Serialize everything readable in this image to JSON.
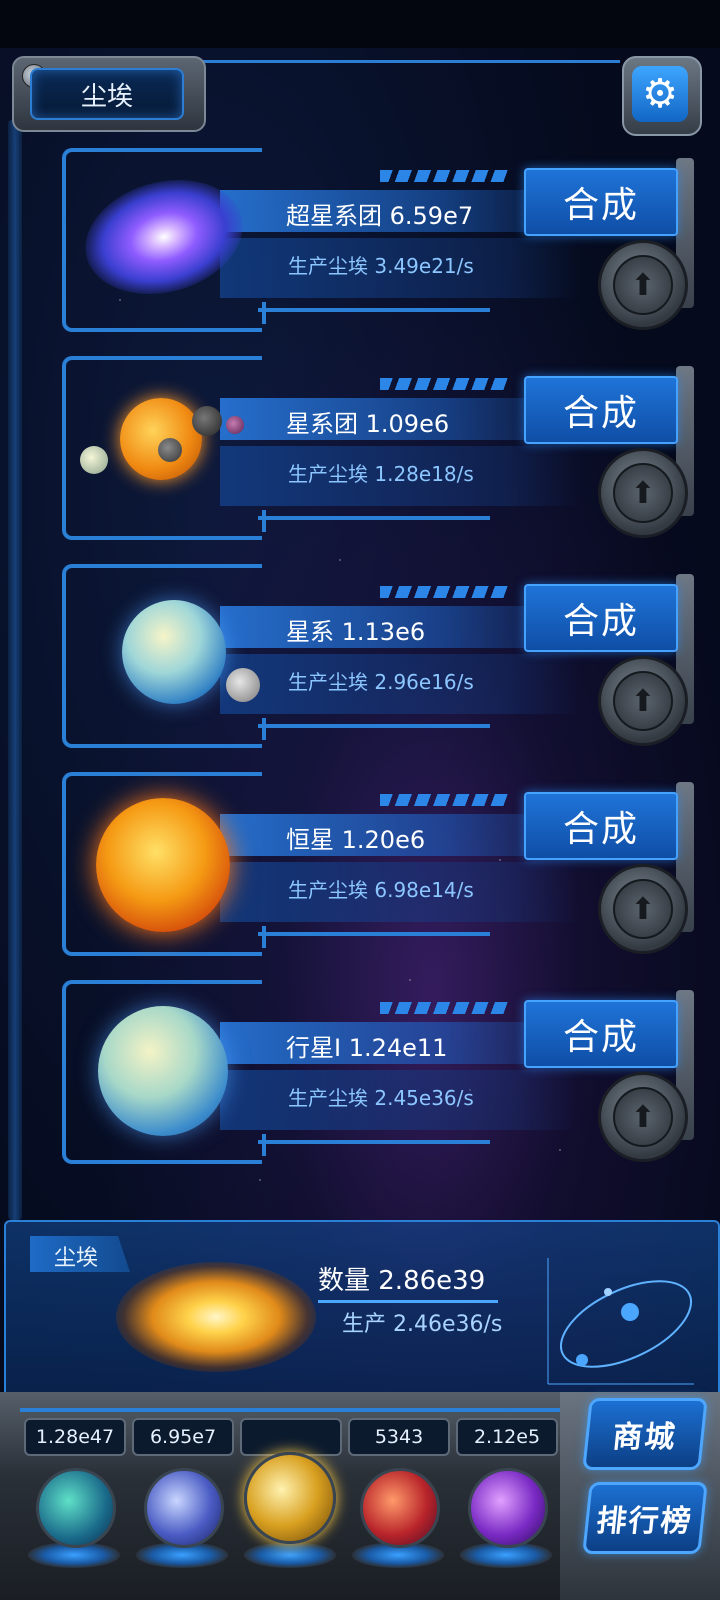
{
  "header": {
    "dust_tab_label": "尘埃",
    "settings_icon": "gear-icon"
  },
  "colors": {
    "accent": "#2a7fd6",
    "panel": "#0f4ea6",
    "background": "#050a1c"
  },
  "items": [
    {
      "name_value": "超星系团 6.59e7",
      "production": "生产尘埃  3.49e21/s",
      "merge_label": "合成",
      "image": "galaxy"
    },
    {
      "name_value": "星系团 1.09e6",
      "production": "生产尘埃  1.28e18/s",
      "merge_label": "合成",
      "image": "solar-system"
    },
    {
      "name_value": "星系 1.13e6",
      "production": "生产尘埃  2.96e16/s",
      "merge_label": "合成",
      "image": "planet-with-ring"
    },
    {
      "name_value": "恒星 1.20e6",
      "production": "生产尘埃  6.98e14/s",
      "merge_label": "合成",
      "image": "star"
    },
    {
      "name_value": "行星I 1.24e11",
      "production": "生产尘埃  2.45e36/s",
      "merge_label": "合成",
      "image": "planet"
    }
  ],
  "resource_panel": {
    "label": "尘埃",
    "quantity": "数量 2.86e39",
    "production": "生产 2.46e36/s"
  },
  "tray": {
    "counters": [
      "1.28e47",
      "6.95e7",
      "",
      "5343",
      "2.12e5"
    ],
    "slots": [
      "atom-orb",
      "lightning-orb",
      "dust-orb",
      "neuron-orb",
      "vortex-orb"
    ],
    "shop_label": "商城",
    "ranking_label": "排行榜"
  }
}
